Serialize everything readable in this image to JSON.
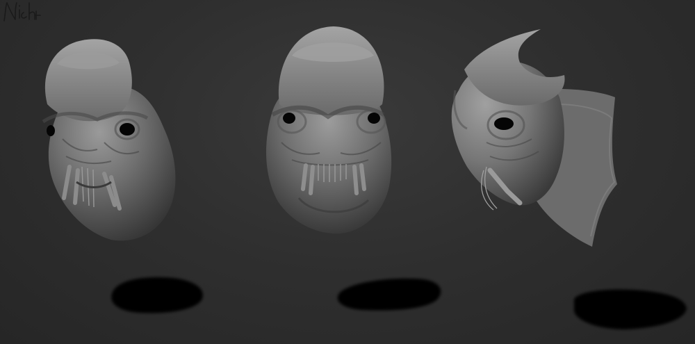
{
  "scene": {
    "description_free": true,
    "colors": {
      "background": "#2f2f2f",
      "clay_light": "#8a8a8a",
      "clay_mid": "#6a6a6a",
      "clay_dark": "#3e3e3e",
      "eye": "#050505",
      "shadow": "#050505"
    },
    "views": [
      {
        "name": "three-quarter-left"
      },
      {
        "name": "front"
      },
      {
        "name": "side-right"
      }
    ],
    "signature": {
      "text": "Nick"
    }
  }
}
